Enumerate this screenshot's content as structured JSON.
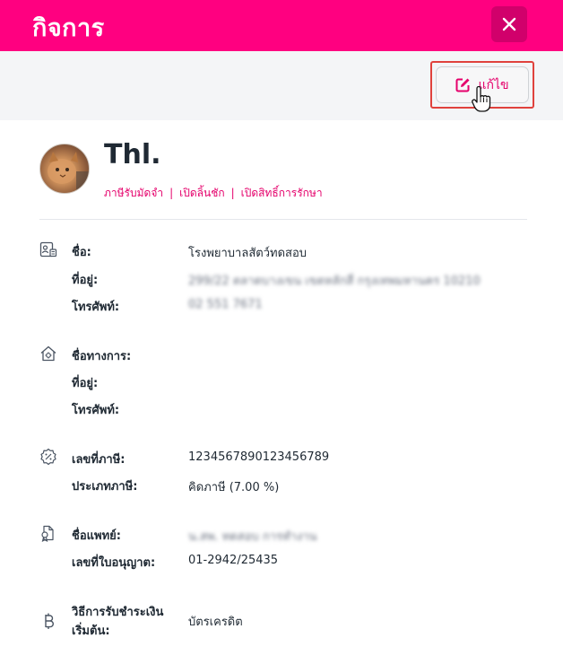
{
  "header": {
    "title": "กิจการ",
    "close_icon": "close-icon"
  },
  "toolbar": {
    "edit_label": "แก้ไข",
    "edit_icon": "edit-icon"
  },
  "profile": {
    "name": "Thl.",
    "links": [
      "ภาษีรับมัดจำ",
      "เปิดลิ้นชัก",
      "เปิดสิทธิ์การรักษา"
    ]
  },
  "sections": {
    "clinic": {
      "icon": "id-card-icon",
      "name_label": "ชื่อ:",
      "name_value": "โรงพยาบาลสัตว์ทดสอบ",
      "address_label": "ที่อยู่:",
      "address_value": "299/22 ตลาดบางเขน เขตหลักสี่ กรุงเทพมหานคร 10210",
      "phone_label": "โทรศัพท์:",
      "phone_value": "02 551 7671"
    },
    "official": {
      "icon": "home-settings-icon",
      "name_label": "ชื่อทางการ:",
      "name_value": "",
      "address_label": "ที่อยู่:",
      "address_value": "",
      "phone_label": "โทรศัพท์:",
      "phone_value": ""
    },
    "tax": {
      "icon": "percent-badge-icon",
      "taxid_label": "เลขที่ภาษี:",
      "taxid_value": "1234567890123456789",
      "taxtype_label": "ประเภทภาษี:",
      "taxtype_value": "คิดภาษี (7.00 %)"
    },
    "doctor": {
      "icon": "doctor-license-icon",
      "name_label": "ชื่อแพทย์:",
      "name_value": "น.สพ. ทดสอบ การทำงาน",
      "license_label": "เลขที่ใบอนุญาต:",
      "license_value": "01-2942/25435"
    },
    "payment": {
      "icon": "baht-icon",
      "method_label_1": "วิธีการรับชำระเงิน",
      "method_label_2": "เริ่มต้น:",
      "method_value": "บัตรเครดิต"
    }
  },
  "colors": {
    "brand": "#ff0080",
    "brand_dark": "#d1006b",
    "link": "#e5006b",
    "highlight": "#e0423d"
  }
}
